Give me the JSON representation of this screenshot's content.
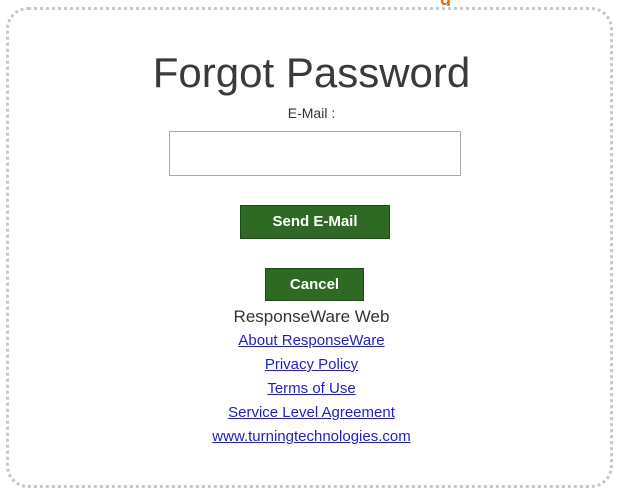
{
  "page": {
    "title": "Forgot Password",
    "top_fragment": "g"
  },
  "form": {
    "email_label": "E-Mail :",
    "email_value": "",
    "email_placeholder": "",
    "send_label": "Send E-Mail",
    "cancel_label": "Cancel"
  },
  "footer": {
    "brand": "ResponseWare Web",
    "links": [
      "About ResponseWare",
      "Privacy Policy",
      "Terms of Use",
      "Service Level Agreement",
      "www.turningtechnologies.com"
    ]
  },
  "colors": {
    "button_bg": "#2f6a25",
    "link": "#1f1fc8",
    "accent": "#e46c0a"
  }
}
